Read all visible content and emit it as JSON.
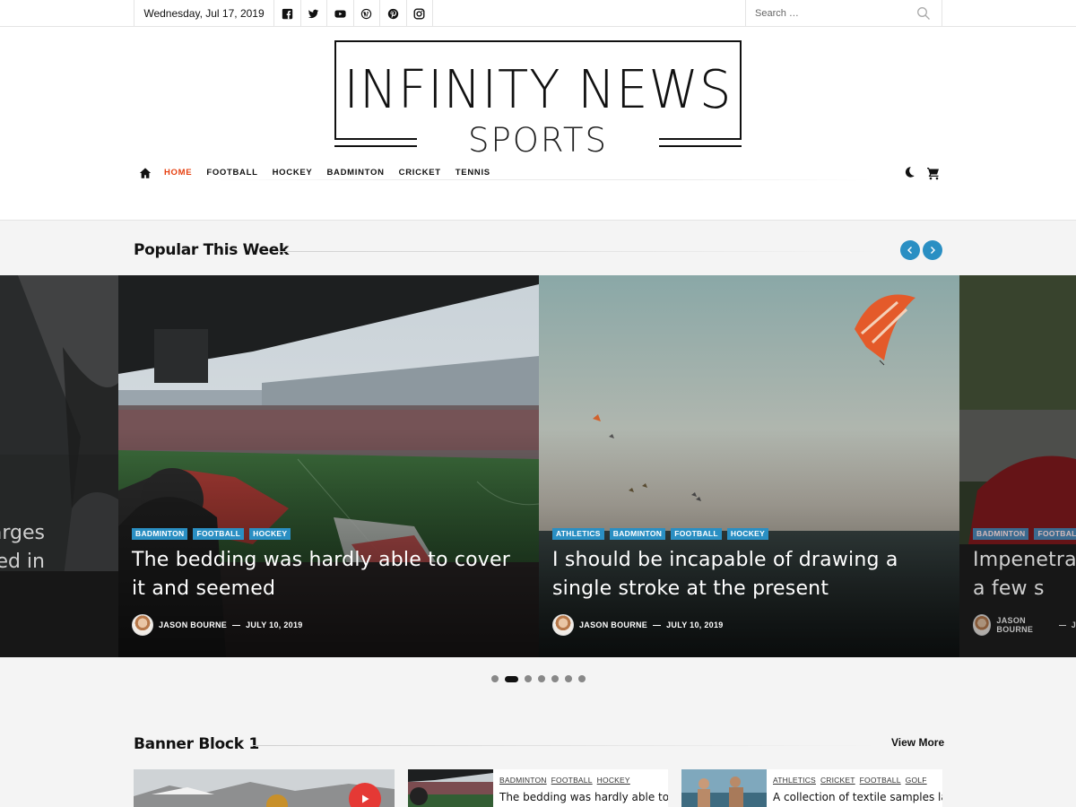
{
  "topbar": {
    "date": "Wednesday, Jul 17, 2019",
    "social_icons": [
      "facebook-icon",
      "twitter-icon",
      "youtube-icon",
      "wordpress-icon",
      "pinterest-icon",
      "instagram-icon"
    ],
    "search_placeholder": "Search …"
  },
  "logo": {
    "line1": "INFINITY NEWS",
    "line2": "SPORTS"
  },
  "nav": {
    "items": [
      {
        "label": "HOME",
        "active": true
      },
      {
        "label": "FOOTBALL"
      },
      {
        "label": "HOCKEY"
      },
      {
        "label": "BADMINTON"
      },
      {
        "label": "CRICKET"
      },
      {
        "label": "TENNIS"
      }
    ]
  },
  "popular": {
    "title": "Popular This Week",
    "slides": [
      {
        "title_fragment": "arges\nied in",
        "partial": true
      },
      {
        "categories": [
          "BADMINTON",
          "FOOTBALL",
          "HOCKEY"
        ],
        "title": "The bedding was hardly able to cover it and seemed",
        "author": "JASON BOURNE",
        "date": "JULY 10, 2019"
      },
      {
        "categories": [
          "ATHLETICS",
          "BADMINTON",
          "FOOTBALL",
          "HOCKEY"
        ],
        "title": "I should be incapable of drawing a single stroke at the present",
        "author": "JASON BOURNE",
        "date": "JULY 10, 2019"
      },
      {
        "categories": [
          "BADMINTON",
          "FOOTBALL"
        ],
        "title": "Impenetral but a few s",
        "author": "JASON BOURNE",
        "date": "J",
        "partial": true
      }
    ],
    "dots_total": 7,
    "dots_active_index": 1
  },
  "banner": {
    "title": "Banner Block 1",
    "view_more": "View More",
    "cards": [
      {
        "categories": [
          "BADMINTON",
          "FOOTBALL",
          "HOCKEY"
        ],
        "title": "The bedding was hardly able to"
      },
      {
        "categories": [
          "ATHLETICS",
          "CRICKET",
          "FOOTBALL",
          "GOLF"
        ],
        "title": "A collection of textile samples lay"
      }
    ]
  },
  "colors": {
    "accent": "#2a8fc3",
    "nav_active": "#e64010",
    "play": "#e53935"
  }
}
